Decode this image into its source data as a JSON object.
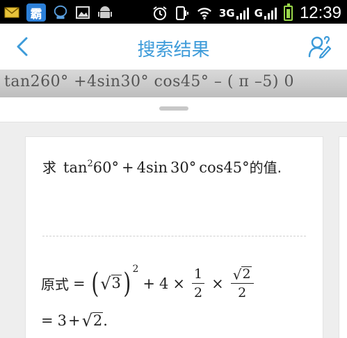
{
  "status_bar": {
    "app_icon_label": "霸",
    "network_3g": "3G",
    "network_g": "G",
    "time": "12:39"
  },
  "header": {
    "title": "搜索结果"
  },
  "scan": {
    "text": "tan260°  +4sin30°  cos45° – ( π –5) 0"
  },
  "question": {
    "prefix": "求",
    "tan": "tan",
    "tan_exp": "2",
    "angle1": "60°",
    "plus": "+",
    "coef": "4",
    "sin": "sin",
    "angle2": "30°",
    "cos": "cos",
    "angle3": "45°",
    "suffix": "的值."
  },
  "solution": {
    "line1_label": "原式",
    "equals": "=",
    "sqrt_radicand": "3",
    "exp": "2",
    "plus": "+",
    "coef": "4",
    "times": "×",
    "frac1_num": "1",
    "frac1_den": "2",
    "frac2_radicand": "2",
    "frac2_den": "2",
    "line2_equals": "=",
    "line2_a": "3",
    "line2_plus": "+",
    "line2_radicand": "2",
    "line2_end": "."
  },
  "icons": [
    "mail-icon",
    "app-ba-icon",
    "chat-icon",
    "image-icon",
    "android-icon",
    "alarm-icon",
    "silent-icon",
    "wifi-icon",
    "signal-icon",
    "battery-icon",
    "back-icon",
    "user-edit-icon"
  ]
}
